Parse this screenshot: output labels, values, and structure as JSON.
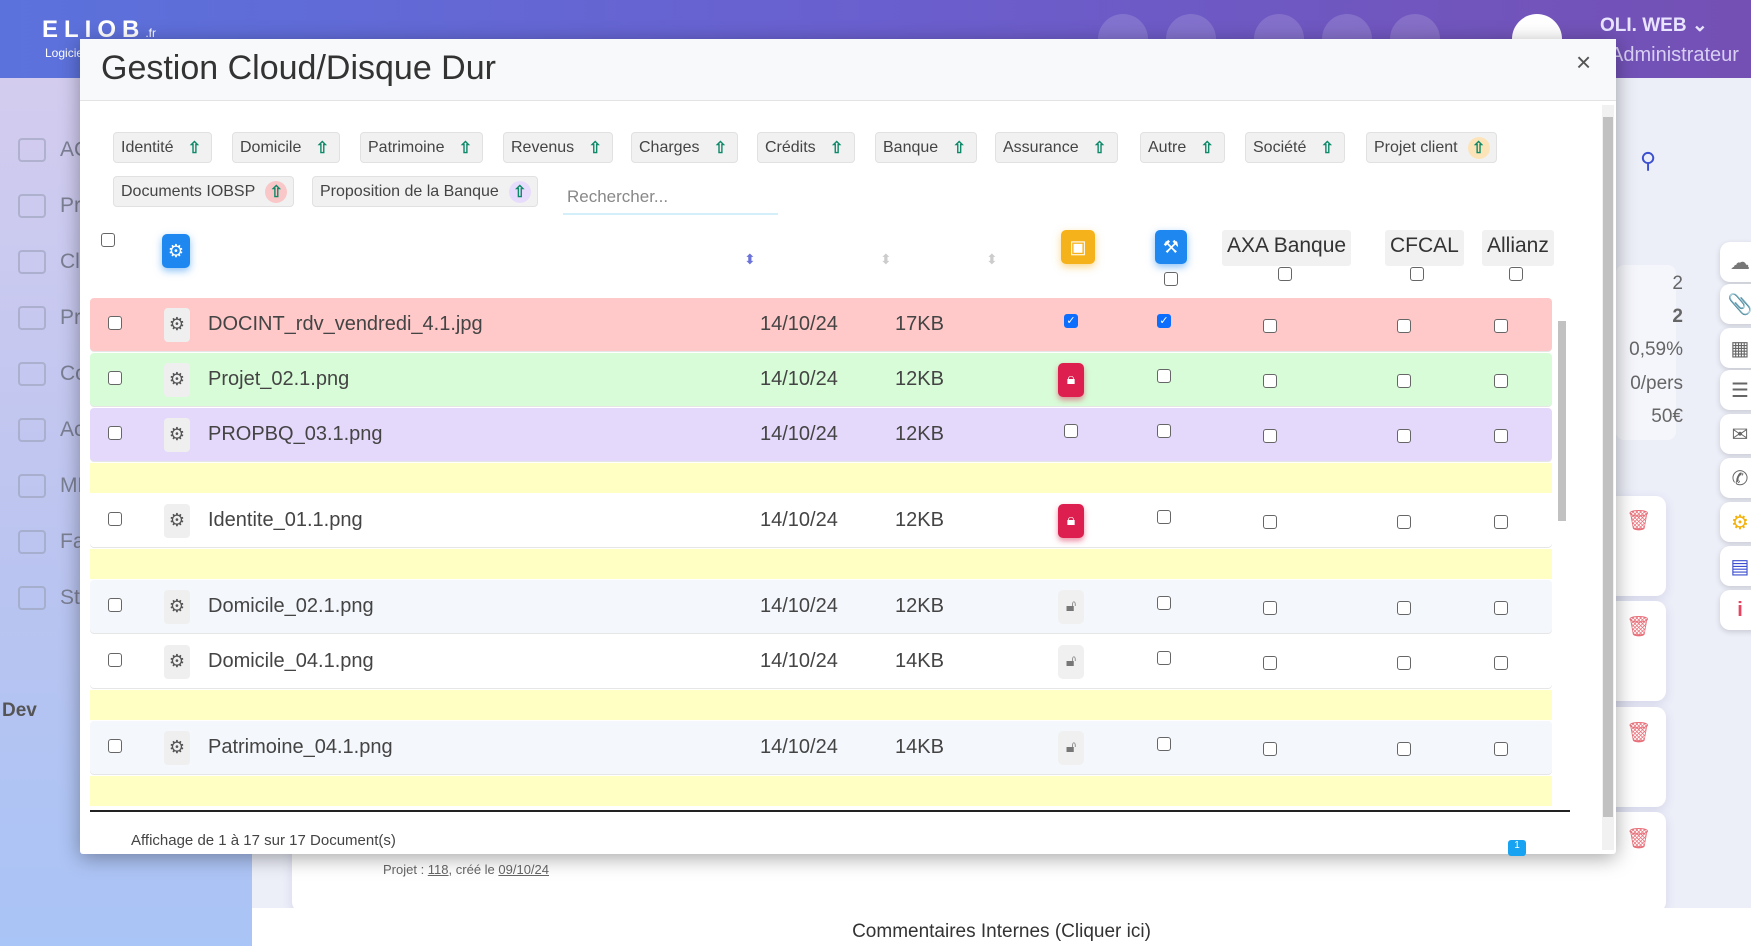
{
  "header": {
    "logo": "ELIOB",
    "logo_suffix": ".fr",
    "logo_sub": "Logiciel",
    "user_name": "OLI. WEB",
    "user_role": "Administrateur"
  },
  "sidebar": {
    "items": [
      "ACCUEIL",
      "Projets",
      "Clients",
      "Produits",
      "Contacts",
      "Actions",
      "MLM",
      "Facturation",
      "Statistiques"
    ],
    "dev": "Dev"
  },
  "background": {
    "stats": [
      "2",
      "2",
      "0,59%",
      "0/pers",
      "50€"
    ],
    "projet_label": "Projet : ",
    "projet_num": "118",
    "projet_mid": ", créé le ",
    "projet_date": "09/10/24",
    "comments": "Commentaires Internes (Cliquer ici)"
  },
  "modal": {
    "title": "Gestion Cloud/Disque Dur",
    "close": "×",
    "tags": [
      {
        "label": "Identité",
        "hl": ""
      },
      {
        "label": "Domicile",
        "hl": ""
      },
      {
        "label": "Patrimoine",
        "hl": ""
      },
      {
        "label": "Revenus",
        "hl": ""
      },
      {
        "label": "Charges",
        "hl": ""
      },
      {
        "label": "Crédits",
        "hl": ""
      },
      {
        "label": "Banque",
        "hl": ""
      },
      {
        "label": "Assurance",
        "hl": ""
      },
      {
        "label": "Autre",
        "hl": ""
      },
      {
        "label": "Société",
        "hl": ""
      },
      {
        "label": "Projet client",
        "hl": "#fde4b8"
      },
      {
        "label": "Documents IOBSP",
        "hl": "#f9c7c7"
      },
      {
        "label": "Proposition de la Banque",
        "hl": "#e7dcfb"
      }
    ],
    "search_placeholder": "Rechercher...",
    "columns": {
      "axa": "AXA Banque",
      "cfcal": "CFCAL",
      "allianz": "Allianz"
    },
    "rows": [
      {
        "type": "file",
        "name": "DOCINT_rdv_vendredi_4.1.jpg",
        "date": "14/10/24",
        "size": "17KB",
        "bg": "#ffc9c9",
        "lock": "checked",
        "col2": true
      },
      {
        "type": "file",
        "name": "Projet_02.1.png",
        "date": "14/10/24",
        "size": "12KB",
        "bg": "#d8fcd8",
        "lock": "locked",
        "col2": false
      },
      {
        "type": "file",
        "name": "PROPBQ_03.1.png",
        "date": "14/10/24",
        "size": "12KB",
        "bg": "#e5d9fb",
        "lock": "unchecked",
        "col2": false
      },
      {
        "type": "sep"
      },
      {
        "type": "file",
        "name": "Identite_01.1.png",
        "date": "14/10/24",
        "size": "12KB",
        "bg": "#ffffff",
        "lock": "locked",
        "col2": false
      },
      {
        "type": "sep"
      },
      {
        "type": "file",
        "name": "Domicile_02.1.png",
        "date": "14/10/24",
        "size": "12KB",
        "bg": "#f4f7fb",
        "lock": "unlocked",
        "col2": false
      },
      {
        "type": "file",
        "name": "Domicile_04.1.png",
        "date": "14/10/24",
        "size": "14KB",
        "bg": "#ffffff",
        "lock": "unlocked",
        "col2": false
      },
      {
        "type": "sep"
      },
      {
        "type": "file",
        "name": "Patrimoine_04.1.png",
        "date": "14/10/24",
        "size": "14KB",
        "bg": "#f4f7fb",
        "lock": "unlocked",
        "col2": false
      },
      {
        "type": "sep"
      },
      {
        "type": "file",
        "name": "",
        "date": "",
        "size": "",
        "bg": "#ffffff",
        "lock": "locked",
        "col2": false
      }
    ],
    "footer": "Affichage de 1 à 17 sur 17 Document(s)",
    "page": "1"
  },
  "colors": {
    "sep": "#ffffc4",
    "upload": "#0e8a6a",
    "lock_red": "#dc1f4e",
    "accent": "#0d6efd"
  }
}
